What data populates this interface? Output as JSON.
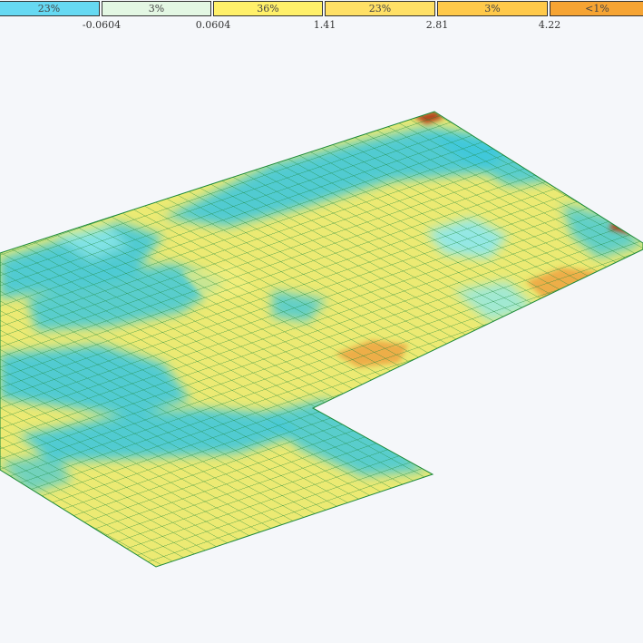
{
  "legend": {
    "bins": [
      {
        "label": "23%",
        "color": "#66d9f2"
      },
      {
        "label": "3%",
        "color": "#e3f7e3"
      },
      {
        "label": "36%",
        "color": "#fff06a"
      },
      {
        "label": "23%",
        "color": "#ffe066"
      },
      {
        "label": "3%",
        "color": "#ffc94a"
      },
      {
        "label": "<1%",
        "color": "#f6a433"
      }
    ],
    "ticks": [
      "-0.0604",
      "0.0604",
      "1.41",
      "2.81",
      "4.22"
    ]
  },
  "colors": {
    "background": "#f5f7fa",
    "mesh_line": "#1c8a3a",
    "cyan": "#40c8dc",
    "light_cyan": "#8fe8ea",
    "yellow": "#ecea73",
    "yellow_light": "#f2f07e",
    "orange": "#ee9a3a",
    "dark_red": "#b2451c"
  },
  "model": {
    "shape": "L-shaped slab contour (isometric)",
    "mesh": "quad mesh"
  }
}
